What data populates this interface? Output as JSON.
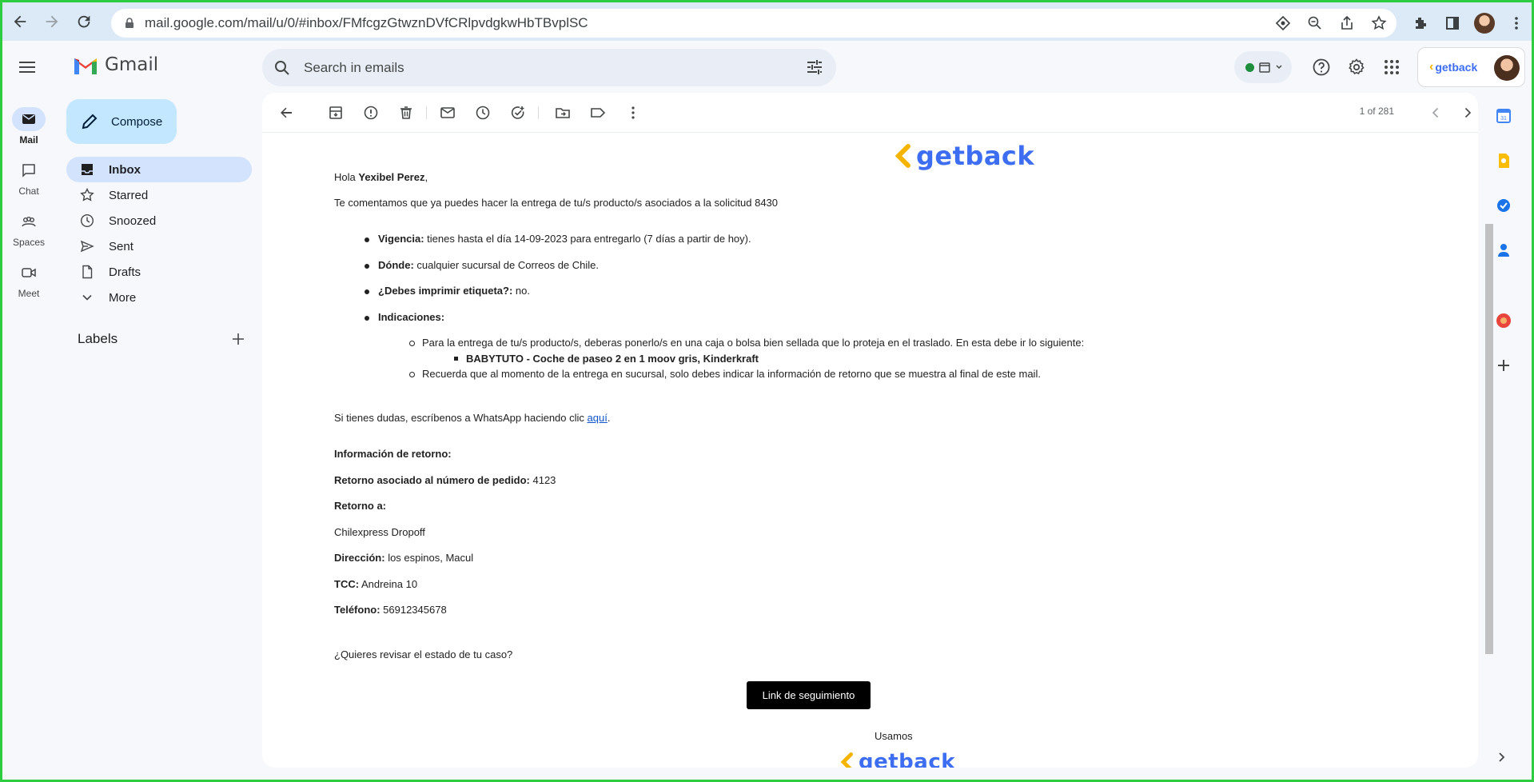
{
  "browser": {
    "url": "mail.google.com/mail/u/0/#inbox/FMfcgzGtwznDVfCRlpvdgkwHbTBvplSC"
  },
  "rail": {
    "items": [
      {
        "label": "Mail"
      },
      {
        "label": "Chat"
      },
      {
        "label": "Spaces"
      },
      {
        "label": "Meet"
      }
    ]
  },
  "header": {
    "app_name": "Gmail",
    "search_placeholder": "Search in emails",
    "account_brand": "getback"
  },
  "sidebar": {
    "compose_label": "Compose",
    "items": [
      {
        "label": "Inbox",
        "icon": "inbox-icon"
      },
      {
        "label": "Starred",
        "icon": "star-icon"
      },
      {
        "label": "Snoozed",
        "icon": "clock-icon"
      },
      {
        "label": "Sent",
        "icon": "send-icon"
      },
      {
        "label": "Drafts",
        "icon": "draft-icon"
      },
      {
        "label": "More",
        "icon": "chevron-down-icon"
      }
    ],
    "labels_title": "Labels"
  },
  "toolbar": {
    "pager": "1 of 281"
  },
  "email": {
    "brand": "getback",
    "greeting_prefix": "Hola ",
    "greeting_name": "Yexibel Perez",
    "greeting_suffix": ",",
    "intro": "Te comentamos que ya puedes hacer la entrega de tu/s producto/s asociados a la solicitud 8430",
    "bullets": [
      {
        "label": "Vigencia:",
        "text": " tienes hasta el día 14-09-2023 para entregarlo (7 días a partir de hoy)."
      },
      {
        "label": "Dónde:",
        "text": " cualquier sucursal de Correos de Chile."
      },
      {
        "label": "¿Debes imprimir etiqueta?:",
        "text": " no."
      },
      {
        "label": "Indicaciones:",
        "text": ""
      }
    ],
    "sub_bullets": [
      "Para la entrega de tu/s producto/s, deberas ponerlo/s en una caja o bolsa bien sellada que lo proteja en el traslado. En esta debe ir lo siguiente:",
      "Recuerda que al momento de la entrega en sucursal, solo debes indicar la información de retorno que se muestra al final de este mail."
    ],
    "product": "BABYTUTO - Coche de paseo 2 en 1 moov gris, Kinderkraft",
    "whatsapp_text": "Si tienes dudas, escríbenos a WhatsApp haciendo clic ",
    "whatsapp_link": "aquí",
    "whatsapp_end": ".",
    "return_title": "Información de retorno:",
    "return_order_label": "Retorno asociado al número de pedido:",
    "return_order_value": " 4123",
    "return_to_label": "Retorno a:",
    "return_to_value": "Chilexpress Dropoff",
    "address_label": "Dirección:",
    "address_value": " los espinos, Macul",
    "tcc_label": "TCC:",
    "tcc_value": " Andreina 10",
    "phone_label": "Teléfono:",
    "phone_value": " 56912345678",
    "status_question": "¿Quieres revisar el estado de tu caso?",
    "cta_label": "Link de seguimiento",
    "footer_text": "Usamos",
    "footer_brand": "getback"
  }
}
